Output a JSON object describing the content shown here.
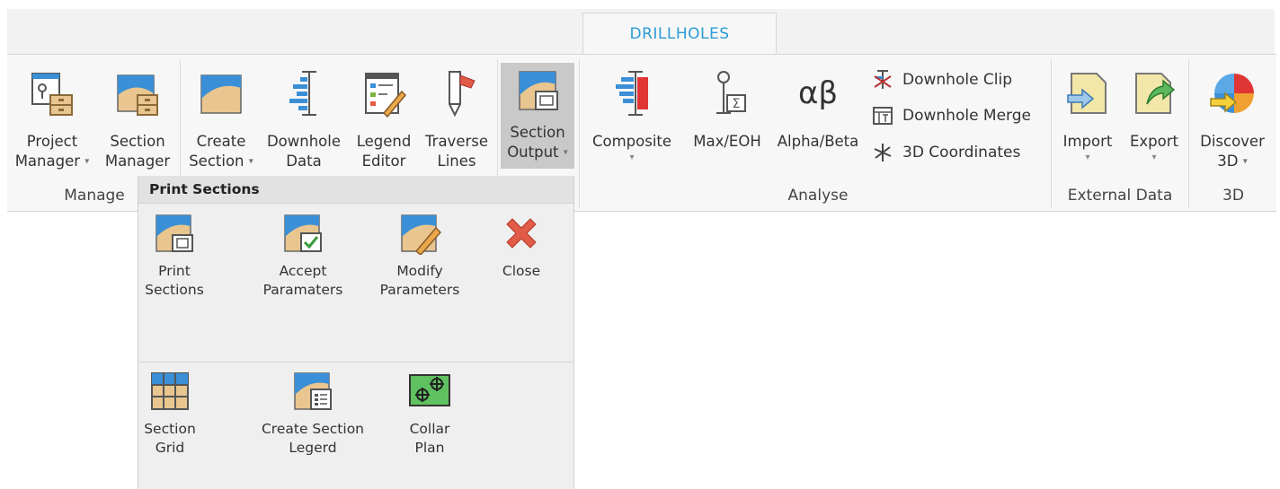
{
  "tab": {
    "label": "DRILLHOLES"
  },
  "buttons": {
    "project_manager": {
      "line1": "Project",
      "line2": "Manager",
      "caret": "▾"
    },
    "section_manager": {
      "line1": "Section",
      "line2": "Manager"
    },
    "create_section": {
      "line1": "Create",
      "line2": "Section",
      "caret": "▾"
    },
    "downhole_data": {
      "line1": "Downhole",
      "line2": "Data"
    },
    "legend_editor": {
      "line1": "Legend",
      "line2": "Editor"
    },
    "traverse_lines": {
      "line1": "Traverse",
      "line2": "Lines"
    },
    "section_output": {
      "line1": "Section",
      "line2": "Output",
      "caret": "▾"
    },
    "composite": {
      "line1": "Composite",
      "caret": "▾"
    },
    "max_eoh": {
      "line1": "Max/EOH"
    },
    "alpha_beta": {
      "line1": "Alpha/Beta",
      "glyph": "αβ"
    },
    "import": {
      "line1": "Import",
      "caret": "▾"
    },
    "export": {
      "line1": "Export",
      "caret": "▾"
    },
    "discover_3d": {
      "line1": "Discover",
      "line2": "3D",
      "caret": "▾"
    }
  },
  "small_buttons": {
    "downhole_clip": "Downhole Clip",
    "downhole_merge": "Downhole Merge",
    "coordinates_3d": "3D Coordinates"
  },
  "groups": {
    "manage": "Manage",
    "analyse": "Analyse",
    "external_data": "External Data",
    "three_d": "3D"
  },
  "dropdown": {
    "header": "Print Sections",
    "print_sections": {
      "line1": "Print",
      "line2": "Sections"
    },
    "accept_parameters": {
      "line1": "Accept",
      "line2": "Paramaters"
    },
    "modify_parameters": {
      "line1": "Modify",
      "line2": "Parameters"
    },
    "close": {
      "line1": "Close"
    },
    "section_grid": {
      "line1": "Section",
      "line2": "Grid"
    },
    "create_section_legend": {
      "line1": "Create Section",
      "line2": "Legerd"
    },
    "collar_plan": {
      "line1": "Collar",
      "line2": "Plan"
    }
  },
  "colors": {
    "accent": "#2b9bd6",
    "map_blue": "#3a8fd6",
    "map_sand": "#e9c58f",
    "close_red": "#e25a48"
  }
}
